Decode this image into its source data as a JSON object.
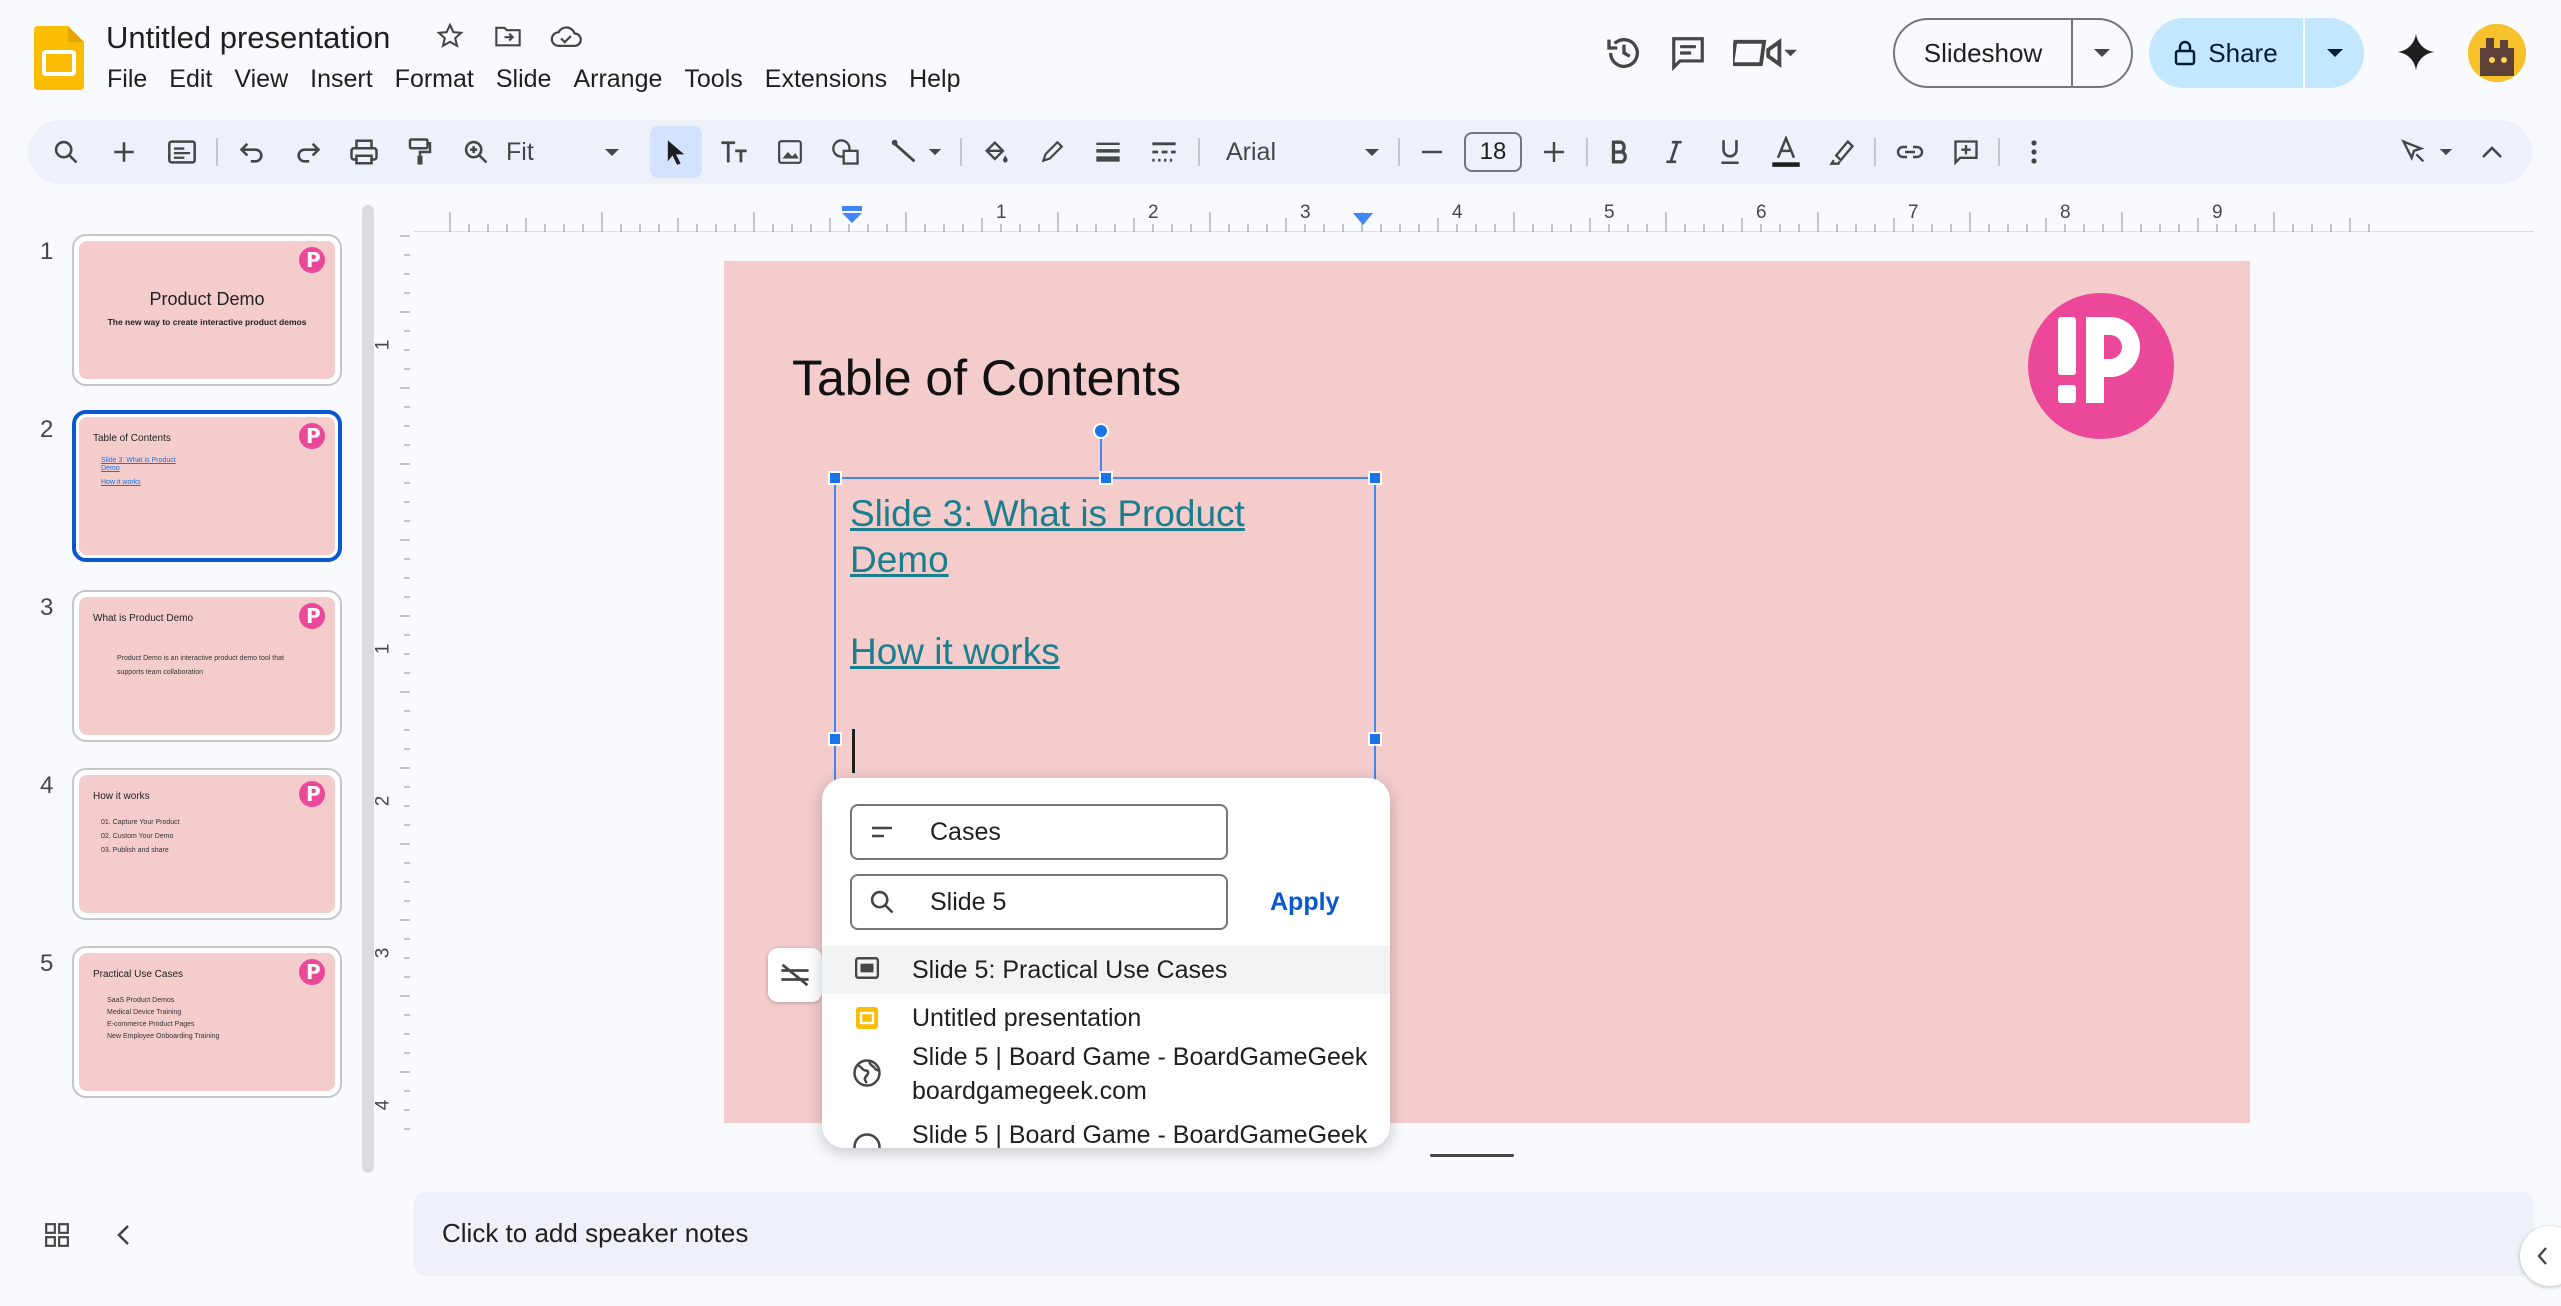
{
  "header": {
    "doc_title": "Untitled presentation",
    "menus": [
      "File",
      "Edit",
      "View",
      "Insert",
      "Format",
      "Slide",
      "Arrange",
      "Tools",
      "Extensions",
      "Help"
    ],
    "slideshow_label": "Slideshow",
    "share_label": "Share"
  },
  "toolbar": {
    "zoom": "Fit",
    "font": "Arial",
    "font_size": "18"
  },
  "slides": [
    {
      "num": "1",
      "title": "Product Demo",
      "subtitle": "The new way to create interactive product demos"
    },
    {
      "num": "2",
      "title": "Table of Contents",
      "lines": [
        "Slide 3: What is Product",
        "Demo",
        "How it works"
      ]
    },
    {
      "num": "3",
      "title": "What is Product Demo",
      "lines": [
        "Product Demo is an interactive product demo tool that",
        "supports team collaboration"
      ]
    },
    {
      "num": "4",
      "title": "How it works",
      "lines": [
        "01. Capture Your Product",
        "02. Custom Your Demo",
        "03. Publish and share"
      ]
    },
    {
      "num": "5",
      "title": "Practical Use Cases",
      "lines": [
        "SaaS Product Demos",
        "Medical Device Training",
        "E-commerce Product Pages",
        "New Employee Onboarding Training"
      ]
    }
  ],
  "ruler": {
    "h": [
      "1",
      "2",
      "3",
      "4",
      "5",
      "6",
      "7",
      "8",
      "9"
    ],
    "v": [
      "1",
      "1",
      "2",
      "3",
      "4"
    ]
  },
  "slide": {
    "title": "Table of Contents",
    "link1": "Slide 3: What is Product Demo",
    "link2": "How it works"
  },
  "link_popup": {
    "text_value": "Cases",
    "search_value": "Slide 5",
    "apply_label": "Apply",
    "results": [
      {
        "title": "Slide 5: Practical Use Cases",
        "icon": "slide-icon"
      },
      {
        "title": "Untitled presentation",
        "icon": "slides-file-icon"
      },
      {
        "title": "Slide 5 | Board Game - BoardGameGeek",
        "sub": "boardgamegeek.com",
        "icon": "globe-icon"
      },
      {
        "title": "Slide 5 | Board Game - BoardGameGeek",
        "icon": "globe-icon"
      }
    ]
  },
  "notes": {
    "placeholder": "Click to add speaker notes"
  },
  "colors": {
    "accent": "#0b57d0",
    "slide_bg": "#f4cccc",
    "logo_pink": "#ec4899",
    "link_teal": "#1a7f8c",
    "share_bg": "#c2e7ff"
  }
}
